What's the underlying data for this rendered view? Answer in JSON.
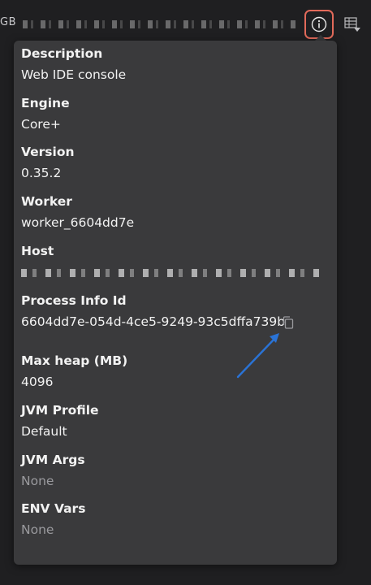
{
  "topbar": {
    "left_text": "GB",
    "info_icon": "info-icon",
    "table_icon": "table-dropdown-icon"
  },
  "popover": {
    "fields": [
      {
        "label": "Description",
        "value": "Web IDE console"
      },
      {
        "label": "Engine",
        "value": "Core+"
      },
      {
        "label": "Version",
        "value": "0.35.2"
      },
      {
        "label": "Worker",
        "value": "worker_6604dd7e"
      },
      {
        "label": "Host",
        "value": ""
      },
      {
        "label": "Process Info Id",
        "value": "6604dd7e-054d-4ce5-9249-93c5dffa739b"
      },
      {
        "label": "Max heap (MB)",
        "value": "4096"
      },
      {
        "label": "JVM Profile",
        "value": "Default"
      },
      {
        "label": "JVM Args",
        "value": "None"
      },
      {
        "label": "ENV Vars",
        "value": "None"
      }
    ],
    "copy_icon": "copy-icon"
  },
  "colors": {
    "highlight": "#e26a5a",
    "annotation_arrow": "#2a73d6",
    "popover_bg": "#3a3a3c"
  }
}
